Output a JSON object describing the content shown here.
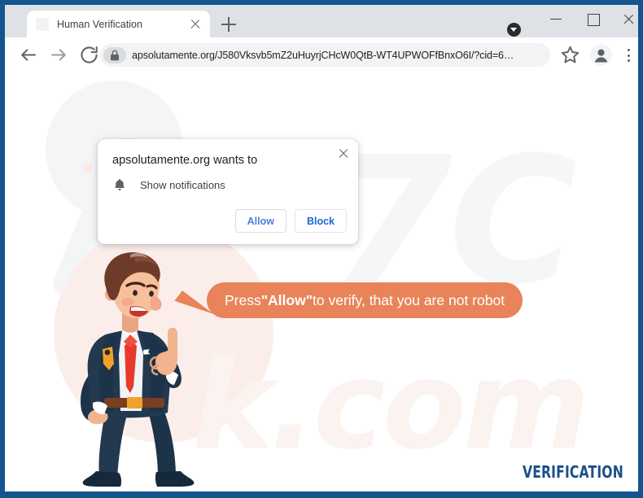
{
  "browser": {
    "tab": {
      "title": "Human Verification",
      "close_label": "close-tab",
      "favicon": "blank-favicon"
    },
    "new_tab_label": "+",
    "window_controls": {
      "download_indicator": "download-arrow-icon",
      "minimize": "minimize-icon",
      "maximize": "maximize-icon",
      "close": "close-icon"
    },
    "toolbar": {
      "back": "back-arrow-icon",
      "forward": "forward-arrow-icon",
      "reload": "reload-icon",
      "lock": "padlock-icon",
      "url": "apsolutamente.org/J580Vksvb5mZ2uHuyrjCHcW0QtB-WT4UPWOFfBnxO6I/?cid=6…",
      "bookmark": "star-icon",
      "profile": "person-avatar-icon",
      "menu": "three-dot-menu-icon"
    }
  },
  "permission_dialog": {
    "origin_title": "apsolutamente.org wants to",
    "permission_icon": "bell-icon",
    "permission_label": "Show notifications",
    "allow_label": "Allow",
    "block_label": "Block",
    "close_label": "close-dialog",
    "allow_color": "#4a7fd4",
    "block_color": "#1967d2"
  },
  "page": {
    "bubble": {
      "text_before": "Press ",
      "text_quoted": "\"Allow\"",
      "text_after": " to verify, that you are not robot",
      "bg_color": "#e8835a",
      "text_color": "#ffffff"
    },
    "watermark": {
      "top_text": "7C",
      "bottom_text": "k.com",
      "color": "#f5f6f7"
    },
    "footer_label": "VERIFICATION",
    "footer_color": "#1b4f8a",
    "character": "cartoon-businessman-pointing-up",
    "cursor": "mouse-arrow-cursor"
  },
  "frame": {
    "border_color": "#14548f"
  }
}
